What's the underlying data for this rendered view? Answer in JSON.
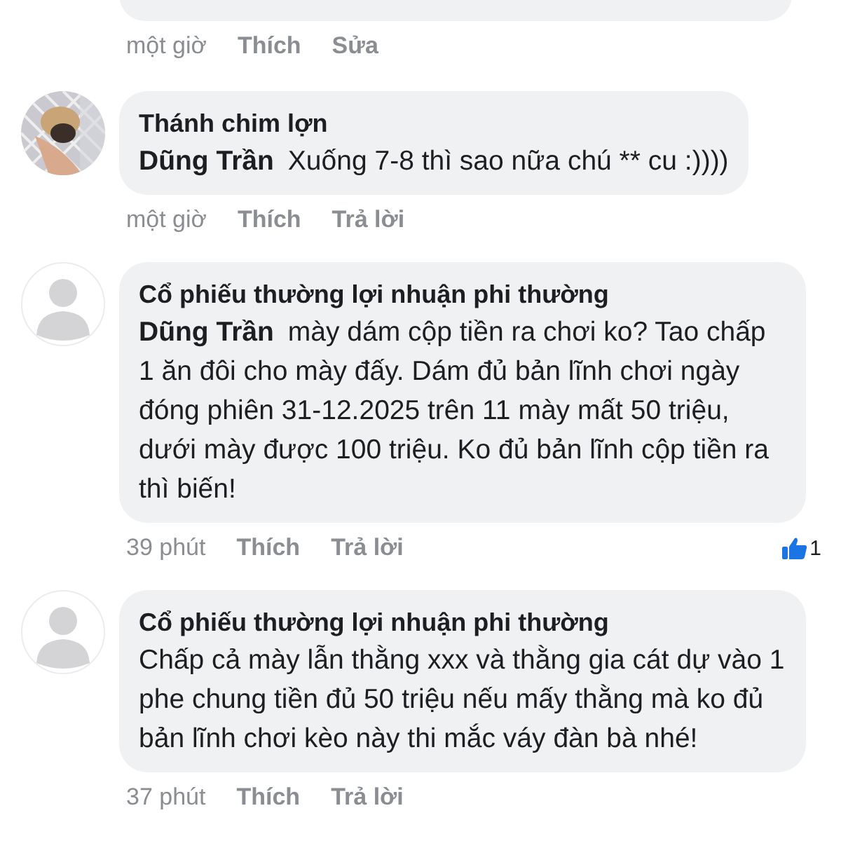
{
  "comments": [
    {
      "kind": "partial",
      "time": "một giờ",
      "actions": [
        "Thích",
        "Sửa"
      ]
    },
    {
      "kind": "full",
      "name": "Thánh chim lợn",
      "tag": "Dũng Trần",
      "text": "Xuống 7-8 thì sao nữa chú ** cu :))))",
      "time": "một giờ",
      "actions": [
        "Thích",
        "Trả lời"
      ]
    },
    {
      "kind": "full",
      "avatar": {
        "kind": "default"
      },
      "name": "Cổ phiếu thường lợi nhuận phi thường",
      "tag": "Dũng Trần",
      "text": "mày dám cộp tiền ra chơi ko? Tao chấp 1 ăn đôi cho mày đấy. Dám đủ bản lĩnh chơi ngày đóng phiên 31-12.2025 trên 11 mày mất 50 triệu, dưới mày được 100 triệu. Ko đủ bản lĩnh cộp tiền ra thì biến!",
      "time": "39 phút",
      "actions": [
        "Thích",
        "Trả lời"
      ],
      "likes": "1"
    },
    {
      "kind": "full",
      "avatar": {
        "kind": "default"
      },
      "name": "Cổ phiếu thường lợi nhuận phi thường",
      "text": "Chấp cả mày lẫn thằng xxx và thằng gia cát dự vào 1 phe chung tiền đủ 50 triệu nếu mấy thằng mà ko đủ bản lĩnh chơi kèo này thi mắc váy đàn bà nhé!",
      "time": "37 phút",
      "actions": [
        "Thích",
        "Trả lời"
      ]
    }
  ]
}
